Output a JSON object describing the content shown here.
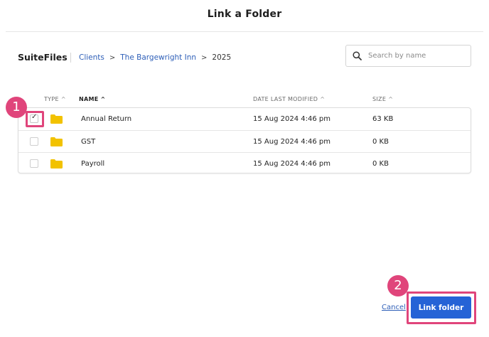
{
  "dialog": {
    "title": "Link a Folder"
  },
  "header": {
    "brand": "SuiteFiles",
    "breadcrumb": {
      "clients": "Clients",
      "client": "The Bargewright Inn",
      "current": "2025",
      "separator": ">"
    },
    "search": {
      "placeholder": "Search by name",
      "value": ""
    }
  },
  "table": {
    "columns": {
      "type": "TYPE",
      "name": "NAME",
      "modified": "DATE LAST MODIFIED",
      "size": "SIZE"
    },
    "sort_up": "^",
    "rows": [
      {
        "name": "Annual Return",
        "modified": "15 Aug 2024 4:46 pm",
        "size": "63 KB",
        "checked": true
      },
      {
        "name": "GST",
        "modified": "15 Aug 2024 4:46 pm",
        "size": "0 KB",
        "checked": false
      },
      {
        "name": "Payroll",
        "modified": "15 Aug 2024 4:46 pm",
        "size": "0 KB",
        "checked": false
      }
    ]
  },
  "annotations": {
    "step1": "1",
    "step2": "2"
  },
  "footer": {
    "cancel": "Cancel",
    "link": "Link folder"
  },
  "colors": {
    "accent": "#2563d6",
    "link": "#2e5fb8",
    "highlight": "#e0457b",
    "folder": "#f2c200"
  },
  "icons": {
    "check": "✓",
    "folder": "folder-icon",
    "search": "search-icon"
  }
}
